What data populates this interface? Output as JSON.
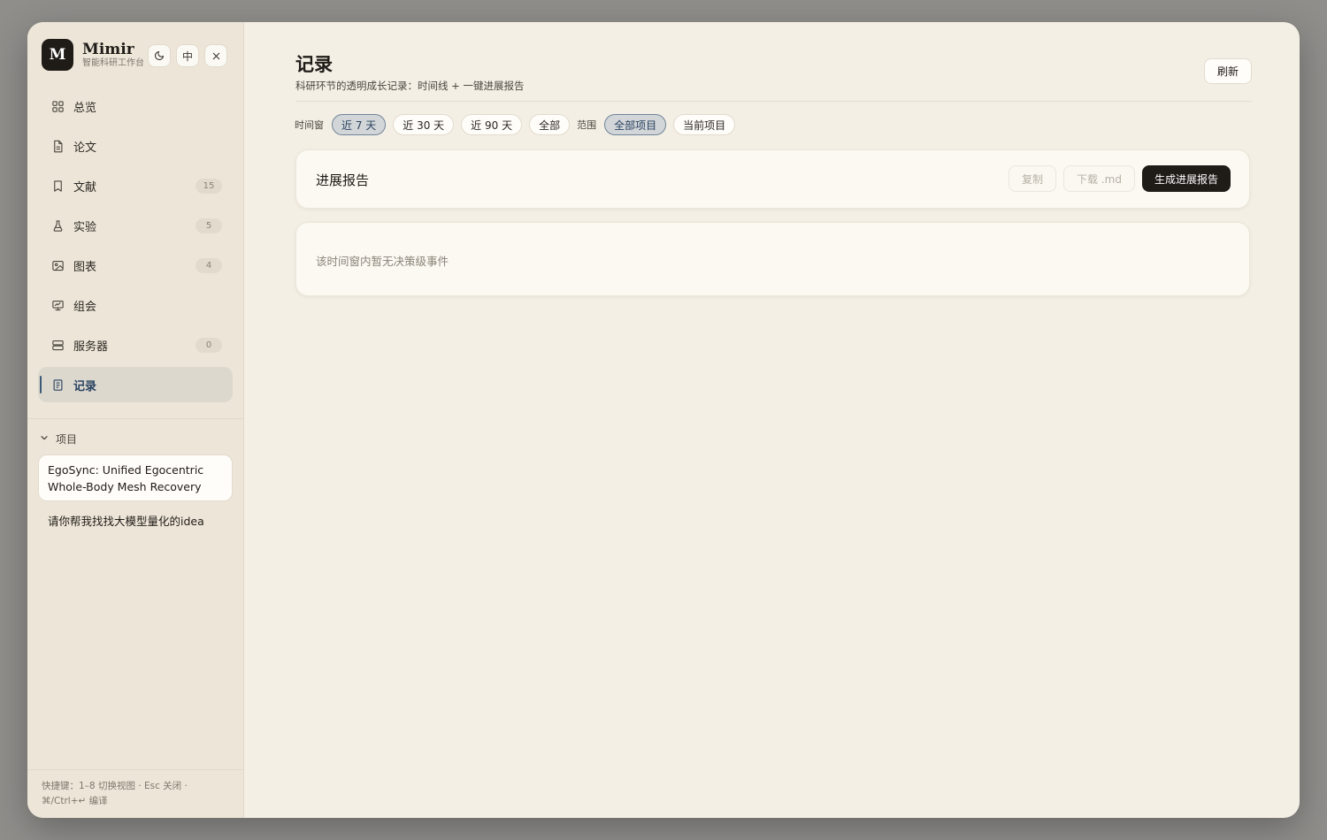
{
  "app": {
    "logo_letter": "M",
    "name": "Mimir",
    "subtitle": "智能科研工作台",
    "theme_icon": "moon-icon",
    "lang_label": "中",
    "close_icon": "close-icon"
  },
  "nav": [
    {
      "label": "总览",
      "icon": "grid-icon",
      "badge": null,
      "active": false
    },
    {
      "label": "论文",
      "icon": "document-icon",
      "badge": null,
      "active": false
    },
    {
      "label": "文献",
      "icon": "bookmark-icon",
      "badge": "15",
      "active": false
    },
    {
      "label": "实验",
      "icon": "flask-icon",
      "badge": "5",
      "active": false
    },
    {
      "label": "图表",
      "icon": "image-icon",
      "badge": "4",
      "active": false
    },
    {
      "label": "组会",
      "icon": "presentation-icon",
      "badge": null,
      "active": false
    },
    {
      "label": "服务器",
      "icon": "server-icon",
      "badge": "0",
      "active": false
    },
    {
      "label": "记录",
      "icon": "journal-icon",
      "badge": null,
      "active": true
    }
  ],
  "projects": {
    "heading": "项目",
    "items": [
      {
        "title": "EgoSync: Unified Egocentric Whole-Body Mesh Recovery",
        "selected": true
      },
      {
        "title": "请你帮我找找大模型量化的idea",
        "selected": false
      }
    ]
  },
  "shortcut_hint": "快捷键：1–8 切换视图 · Esc 关闭 · ⌘/Ctrl+↵ 编译",
  "page": {
    "title": "记录",
    "subtitle": "科研环节的透明成长记录：时间线 + 一键进展报告",
    "refresh_label": "刷新"
  },
  "filters": {
    "time_label": "时间窗",
    "time_options": [
      "近 7 天",
      "近 30 天",
      "近 90 天",
      "全部"
    ],
    "time_selected": "近 7 天",
    "scope_label": "范围",
    "scope_options": [
      "全部项目",
      "当前项目"
    ],
    "scope_selected": "全部项目"
  },
  "report": {
    "title": "进展报告",
    "copy_label": "复制",
    "download_label": "下载 .md",
    "generate_label": "生成进展报告"
  },
  "empty_state": "该时间窗内暂无决策级事件",
  "colors": {
    "accent": "#274260",
    "dark_button": "#1f1b17",
    "background": "#f4efe5",
    "sidebar": "#ede6d8"
  }
}
